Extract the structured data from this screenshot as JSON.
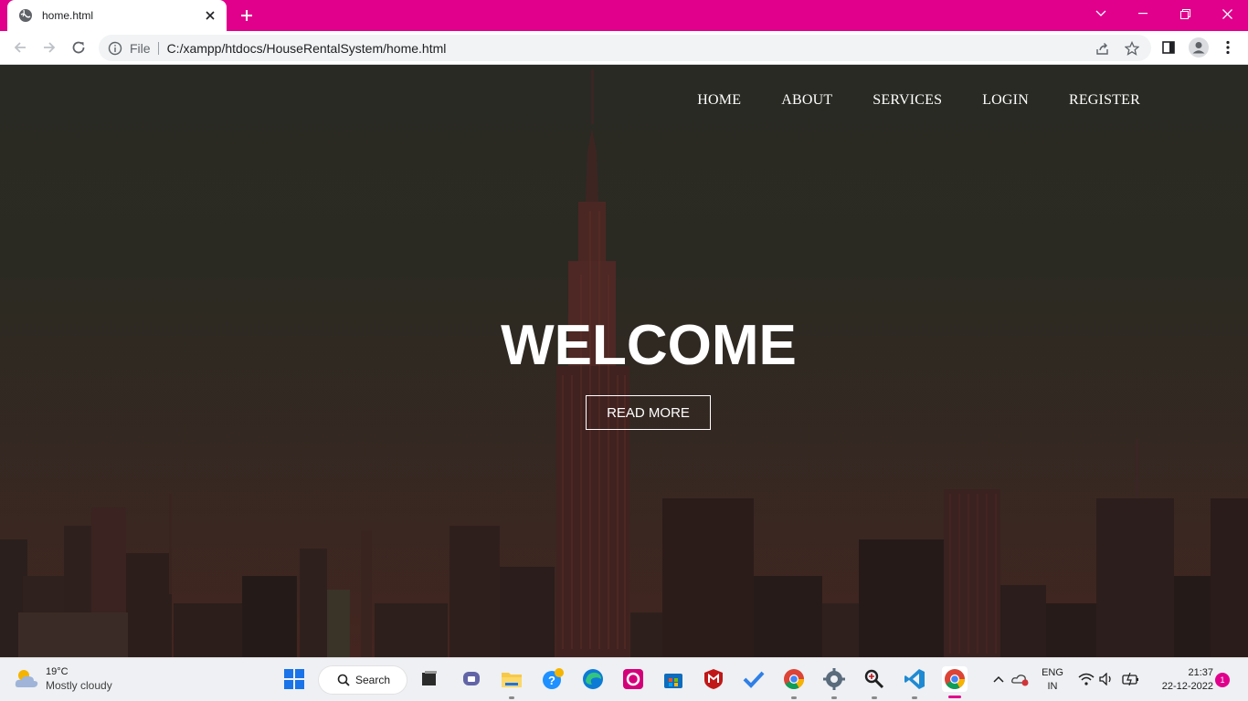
{
  "browser": {
    "tab_title": "home.html",
    "url_scheme": "File",
    "url": "C:/xampp/htdocs/HouseRentalSystem/home.html",
    "accent": "#e0008c"
  },
  "site": {
    "nav": [
      "HOME",
      "ABOUT",
      "SERVICES",
      "LOGIN",
      "REGISTER"
    ],
    "hero_title": "WELCOME",
    "cta_label": "READ MORE"
  },
  "taskbar": {
    "weather_temp": "19°C",
    "weather_cond": "Mostly cloudy",
    "search_label": "Search",
    "lang_line1": "ENG",
    "lang_line2": "IN",
    "time": "21:37",
    "date": "22-12-2022",
    "notification_count": "1",
    "apps": [
      "start-icon",
      "search",
      "task-view-icon",
      "teams-icon",
      "file-explorer-icon",
      "help-icon",
      "edge-icon",
      "app-icon",
      "store-icon",
      "mcafee-icon",
      "todo-icon",
      "chrome-icon",
      "settings-icon",
      "magnifier-icon",
      "vscode-icon",
      "chrome-active-icon"
    ]
  }
}
